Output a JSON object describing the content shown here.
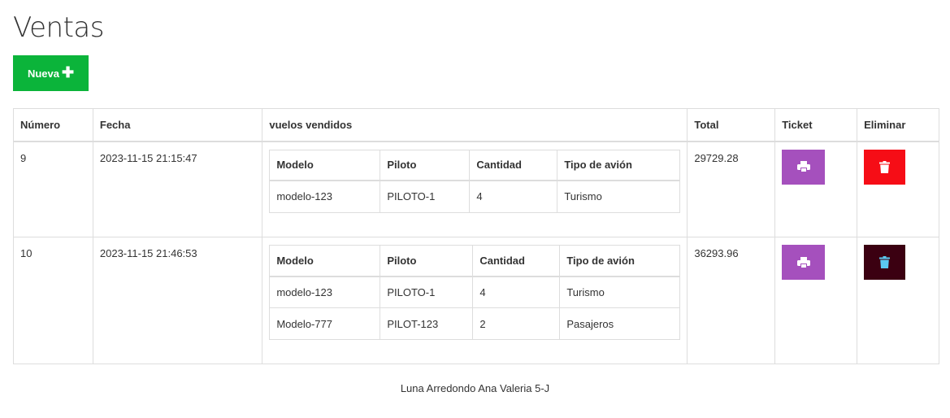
{
  "page": {
    "title": "Ventas"
  },
  "toolbar": {
    "new_label": "Nueva",
    "new_icon": "plus-icon"
  },
  "table": {
    "headers": {
      "numero": "Número",
      "fecha": "Fecha",
      "vuelos": "vuelos vendidos",
      "total": "Total",
      "ticket": "Ticket",
      "eliminar": "Eliminar"
    },
    "inner_headers": {
      "modelo": "Modelo",
      "piloto": "Piloto",
      "cantidad": "Cantidad",
      "tipo": "Tipo de avión"
    },
    "rows": [
      {
        "numero": "9",
        "fecha": "2023-11-15 21:15:47",
        "total": "29729.28",
        "vuelos": [
          {
            "modelo": "modelo-123",
            "piloto": "PILOTO-1",
            "cantidad": "4",
            "tipo": "Turismo"
          }
        ]
      },
      {
        "numero": "10",
        "fecha": "2023-11-15 21:46:53",
        "total": "36293.96",
        "vuelos": [
          {
            "modelo": "modelo-123",
            "piloto": "PILOTO-1",
            "cantidad": "4",
            "tipo": "Turismo"
          },
          {
            "modelo": "Modelo-777",
            "piloto": "PILOT-123",
            "cantidad": "2",
            "tipo": "Pasajeros"
          }
        ]
      }
    ]
  },
  "icons": {
    "print": "print-icon",
    "delete": "trash-icon"
  },
  "colors": {
    "new_button": "#0bb43a",
    "print_button": "#a550bd",
    "delete_button": "#f60d16",
    "delete_button_hover": "#3b0011",
    "hover_icon": "#5bc8f0"
  },
  "footer": {
    "text": "Luna Arredondo Ana Valeria 5-J"
  }
}
